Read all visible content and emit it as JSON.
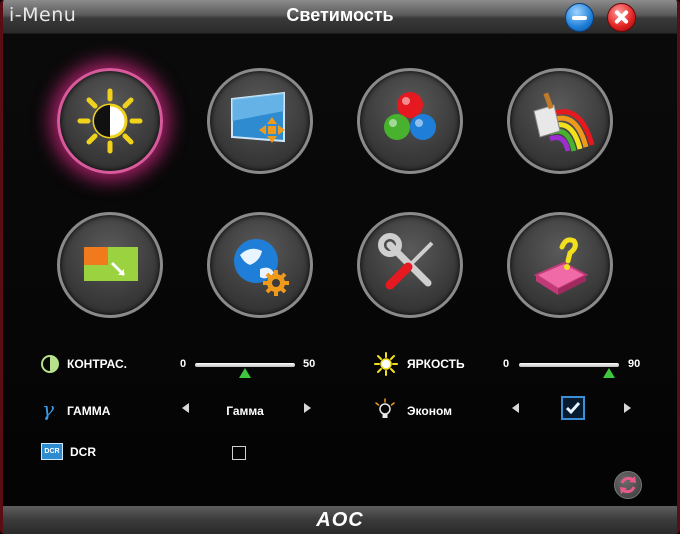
{
  "window": {
    "app_name": "i-Menu",
    "title": "Светимость"
  },
  "tiles": [
    {
      "name": "luminance",
      "active": true
    },
    {
      "name": "image-setup",
      "active": false
    },
    {
      "name": "color-setup",
      "active": false
    },
    {
      "name": "picture-boost",
      "active": false
    },
    {
      "name": "osd-setup",
      "active": false
    },
    {
      "name": "extra",
      "active": false
    },
    {
      "name": "tools",
      "active": false
    },
    {
      "name": "exit",
      "active": false
    }
  ],
  "contrast": {
    "label": "КОНТРАС.",
    "min": "0",
    "value": "50",
    "level": 50,
    "max_level": 100
  },
  "brightness": {
    "label": "ЯРКОСТЬ",
    "min": "0",
    "value": "90",
    "level": 90,
    "max_level": 100
  },
  "gamma": {
    "label": "ГАММА",
    "value": "Гамма"
  },
  "eco": {
    "label": "Эконом",
    "checked": true
  },
  "dcr": {
    "label": "DCR",
    "checked": false
  },
  "footer": {
    "logo": "AOC"
  },
  "colors": {
    "active_glow": "#d82a86",
    "slider_thumb": "#3fc63f",
    "check_accent": "#3b8fd6"
  }
}
